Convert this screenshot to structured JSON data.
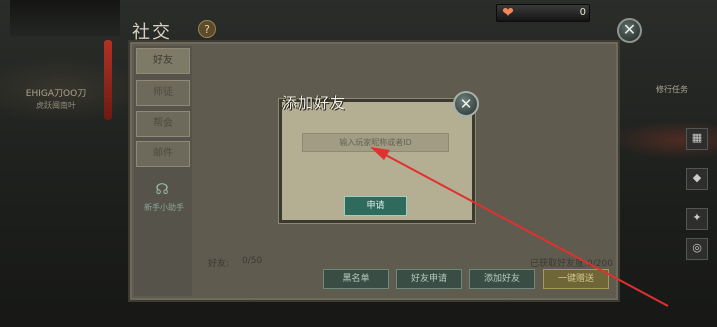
{
  "hud": {
    "player_name": "EHIGA刀OO刀",
    "player_sub": "虎跃闽南叶",
    "heart_value": "0"
  },
  "panel": {
    "title": "社交",
    "help_glyph": "?",
    "close_glyph": "✕",
    "side_tabs": [
      "好友",
      "师徒",
      "帮会",
      "邮件"
    ],
    "helper_label": "新手小助手",
    "friend_count_label": "好友:",
    "friend_count_value": "0/50",
    "received_label": "已获取好友度:0/200",
    "bottom_buttons": [
      "黑名单",
      "好友申请",
      "添加好友",
      "一键赠送"
    ]
  },
  "dialog": {
    "title": "添加好友",
    "close_glyph": "✕",
    "input_placeholder": "输入玩家昵称或者ID",
    "apply_label": "申请"
  },
  "side_quest": "修行任务",
  "colors": {
    "annotation": "#e03030",
    "apply_button": "#2f6b5d",
    "dialog_bg": "#b4ae93"
  }
}
